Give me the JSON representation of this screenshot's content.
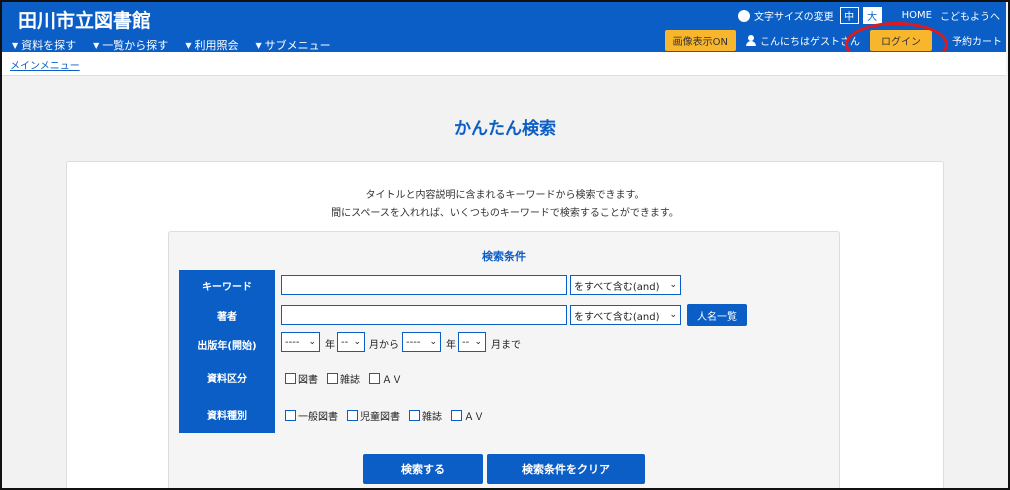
{
  "header": {
    "title": "田川市立図書館",
    "nav": [
      "資料を探す",
      "一覧から探す",
      "利用照会",
      "サブメニュー"
    ],
    "font_size_label": "文字サイズの変更",
    "size_mid": "中",
    "size_large": "大",
    "home": "HOME",
    "kids": "こどもようへ",
    "image_toggle": "画像表示ON",
    "greeting": "こんにちはゲストさん",
    "login": "ログイン",
    "cart": "予約カート"
  },
  "breadcrumb": "メインメニュー",
  "page_title": "かんたん検索",
  "description": [
    "タイトルと内容説明に含まれるキーワードから検索できます。",
    "間にスペースを入れれば、いくつものキーワードで検索することができます。"
  ],
  "criteria": {
    "title": "検索条件",
    "keyword_label": "キーワード",
    "keyword_value": "",
    "keyword_mode": "をすべて含む(and)",
    "author_label": "著者",
    "author_value": "",
    "author_mode": "をすべて含む(and)",
    "name_list": "人名一覧",
    "year_label": "出版年(開始)",
    "year_from": "----",
    "month_from": "--",
    "year_to": "----",
    "month_to": "--",
    "year_unit": "年",
    "month_from_unit": "月から",
    "month_to_unit": "月まで",
    "category_label": "資料区分",
    "categories": [
      "図書",
      "雑誌",
      "ＡＶ"
    ],
    "type_label": "資料種別",
    "types": [
      "一般図書",
      "児童図書",
      "雑誌",
      "ＡＶ"
    ]
  },
  "actions": {
    "search": "検索する",
    "clear": "検索条件をクリア"
  },
  "colors": {
    "primary": "#0a5ec6",
    "accent": "#f8b62d",
    "highlight": "#e31818"
  }
}
